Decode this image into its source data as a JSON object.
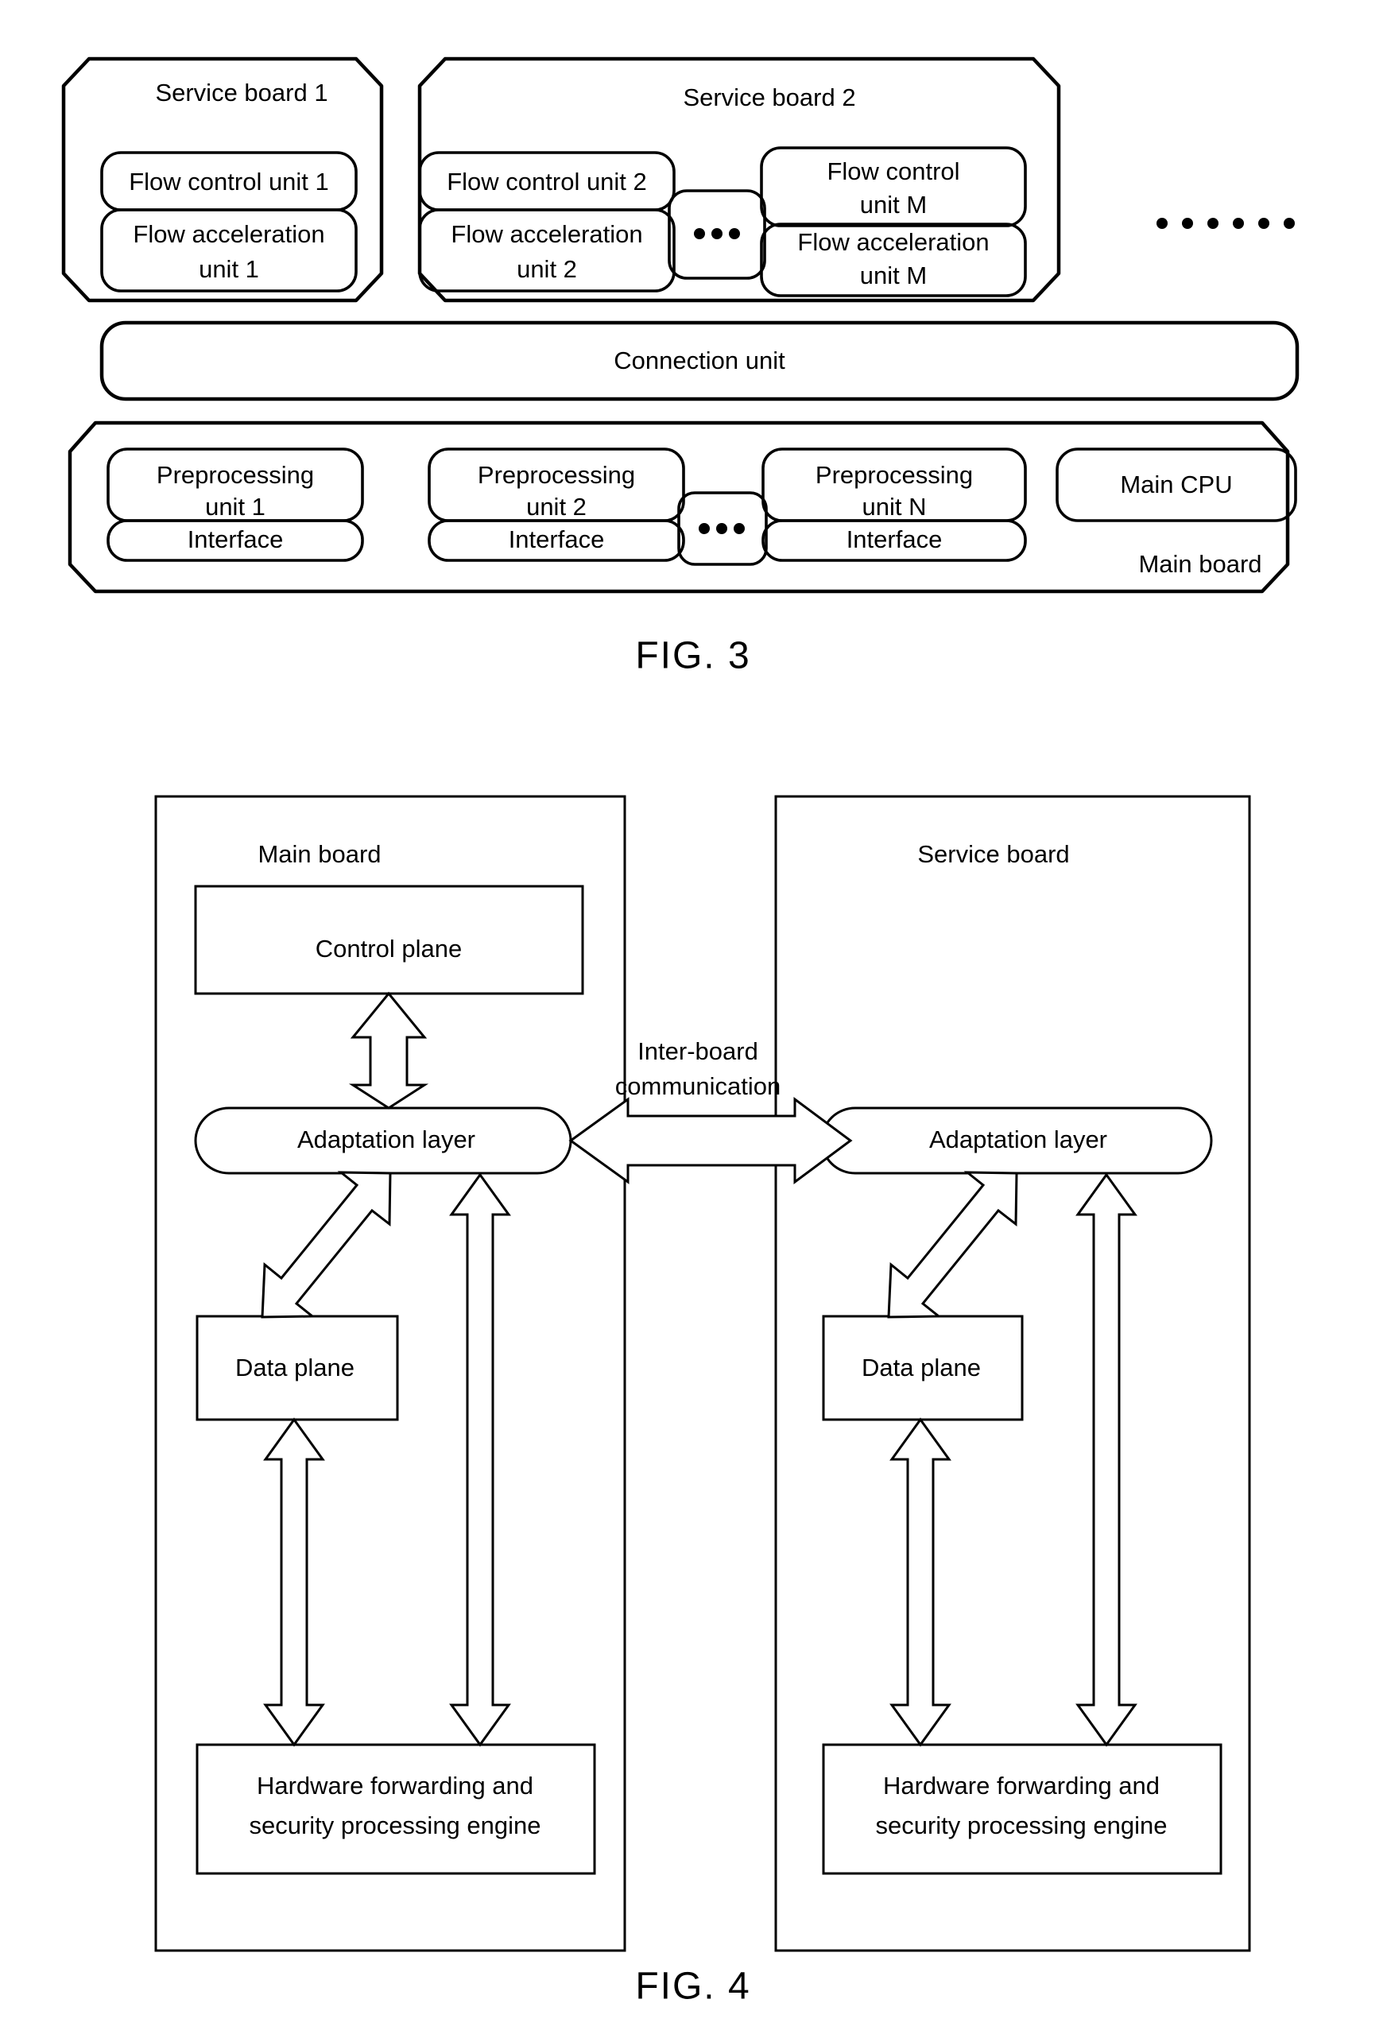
{
  "figures": [
    {
      "id": "fig3",
      "caption": "FIG. 3",
      "service_boards": [
        {
          "title": "Service board 1",
          "units": [
            {
              "line1": "Flow control unit 1",
              "line2": ""
            },
            {
              "line1": "Flow acceleration",
              "line2": "unit 1"
            }
          ]
        },
        {
          "title": "Service board 2",
          "units": [
            {
              "line1": "Flow control unit 2",
              "line2": ""
            },
            {
              "line1": "Flow acceleration",
              "line2": "unit 2"
            }
          ],
          "ellipsis": "...",
          "units_m": [
            {
              "line1": "Flow control",
              "line2": "unit M"
            },
            {
              "line1": "Flow acceleration",
              "line2": "unit M"
            }
          ]
        }
      ],
      "trailing_ellipsis": "......",
      "connection_unit": "Connection unit",
      "main_board": {
        "label": "Main board",
        "preprocessing_units": [
          {
            "line1": "Preprocessing",
            "line2": "unit 1",
            "interface": "Interface"
          },
          {
            "line1": "Preprocessing",
            "line2": "unit 2",
            "interface": "Interface"
          },
          {
            "line1": "Preprocessing",
            "line2": "unit N",
            "interface": "Interface"
          }
        ],
        "ellipsis": "...",
        "cpu": "Main   CPU"
      }
    },
    {
      "id": "fig4",
      "caption": "FIG. 4",
      "inter_board": {
        "line1": "Inter-board",
        "line2": "communication"
      },
      "boards": [
        {
          "title": "Main board",
          "nodes": {
            "top": "Control plane",
            "adaptation": "Adaptation layer",
            "data_plane": "Data plane",
            "engine_line1": "Hardware forwarding and",
            "engine_line2": "security processing engine"
          }
        },
        {
          "title": "Service board",
          "nodes": {
            "adaptation": "Adaptation layer",
            "data_plane": "Data plane",
            "engine_line1": "Hardware forwarding and",
            "engine_line2": "security processing engine"
          }
        }
      ]
    }
  ]
}
